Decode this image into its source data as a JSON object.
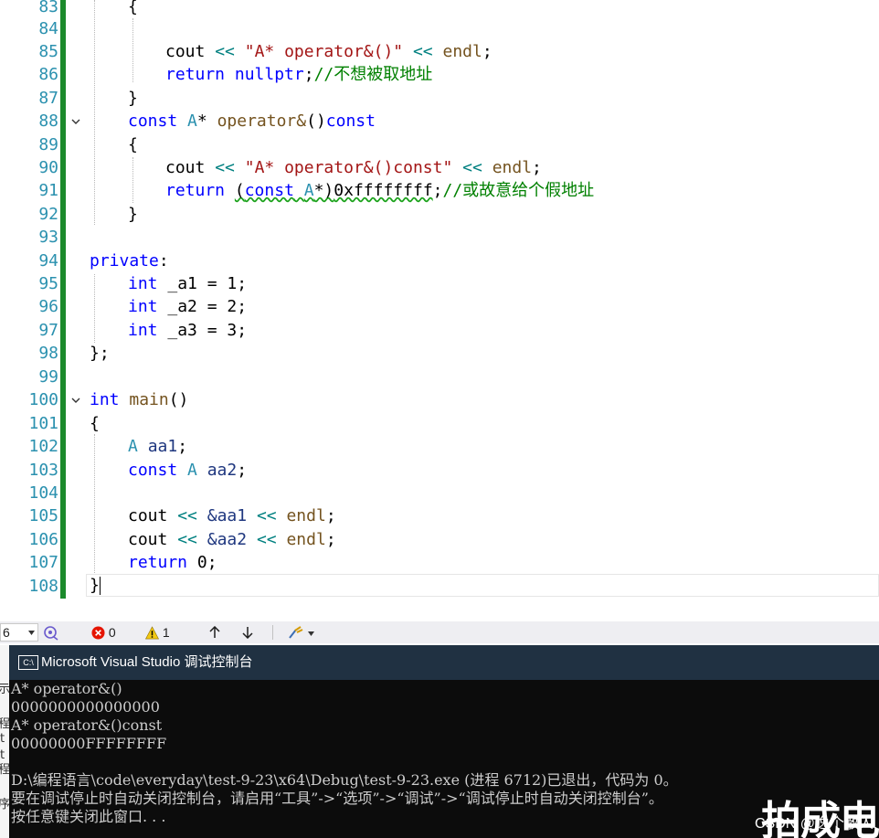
{
  "editor": {
    "line_numbers": [
      "83",
      "84",
      "85",
      "86",
      "87",
      "88",
      "89",
      "90",
      "91",
      "92",
      "93",
      "94",
      "95",
      "96",
      "97",
      "98",
      "99",
      "100",
      "101",
      "102",
      "103",
      "104",
      "105",
      "106",
      "107",
      "108"
    ],
    "code": {
      "l83": "{",
      "l85_cout": "cout",
      "l85_op1": "<<",
      "l85_str": "\"A* operator&()\"",
      "l85_op2": "<<",
      "l85_endl": "endl",
      "l85_semi": ";",
      "l86_ret": "return",
      "l86_null": "nullptr",
      "l86_semi": ";",
      "l86_comment": "//不想被取地址",
      "l87": "}",
      "l88_const": "const",
      "l88_type": "A",
      "l88_star": "*",
      "l88_fn": "operator&",
      "l88_paren": "()",
      "l88_const2": "const",
      "l89": "{",
      "l90_cout": "cout",
      "l90_op1": "<<",
      "l90_str": "\"A* operator&()const\"",
      "l90_op2": "<<",
      "l90_endl": "endl",
      "l90_semi": ";",
      "l91_ret": "return",
      "l91_cast_open": "(",
      "l91_cast_const": "const",
      "l91_cast_type": "A",
      "l91_cast_close": "*)",
      "l91_num": "0xffffffff",
      "l91_semi": ";",
      "l91_comment": "//或故意给个假地址",
      "l92": "}",
      "l94_private": "private",
      "l94_colon": ":",
      "l95_int": "int",
      "l95_rest": "_a1 = 1;",
      "l96_int": "int",
      "l96_rest": "_a2 = 2;",
      "l97_int": "int",
      "l97_rest": "_a3 = 3;",
      "l98": "};",
      "l100_int": "int",
      "l100_fn": "main",
      "l100_paren": "()",
      "l101": "{",
      "l102_type": "A",
      "l102_var": "aa1",
      "l102_semi": ";",
      "l103_const": "const",
      "l103_type": "A",
      "l103_var": "aa2",
      "l103_semi": ";",
      "l105_cout": "cout",
      "l105_op1": "<<",
      "l105_var": "&aa1",
      "l105_op2": "<<",
      "l105_endl": "endl",
      "l105_semi": ";",
      "l106_cout": "cout",
      "l106_op1": "<<",
      "l106_var": "&aa2",
      "l106_op2": "<<",
      "l106_endl": "endl",
      "l106_semi": ";",
      "l107_ret": "return",
      "l107_rest": "0;",
      "l108": "}"
    }
  },
  "statusbar": {
    "zoom": "6",
    "errors": "0",
    "warnings": "1"
  },
  "console": {
    "title": "Microsoft Visual Studio 调试控制台",
    "icon_text": "C:\\",
    "lines": [
      "A* operator&()",
      "0000000000000000",
      "A* operator&()const",
      "00000000FFFFFFFF",
      "",
      "D:\\编程语言\\code\\everyday\\test-9-23\\x64\\Debug\\test-9-23.exe (进程 6712)已退出，代码为 0。",
      "要在调试停止时自动关闭控制台，请启用“工具”->“选项”->“调试”->“调试停止时自动关闭控制台”。",
      "按任意键关闭此窗口. . ."
    ],
    "watermark": "拍成电",
    "credit": "CSDN @逸个散人"
  },
  "left_sliver": [
    "示",
    "程",
    "t",
    "t",
    "程",
    "序"
  ]
}
